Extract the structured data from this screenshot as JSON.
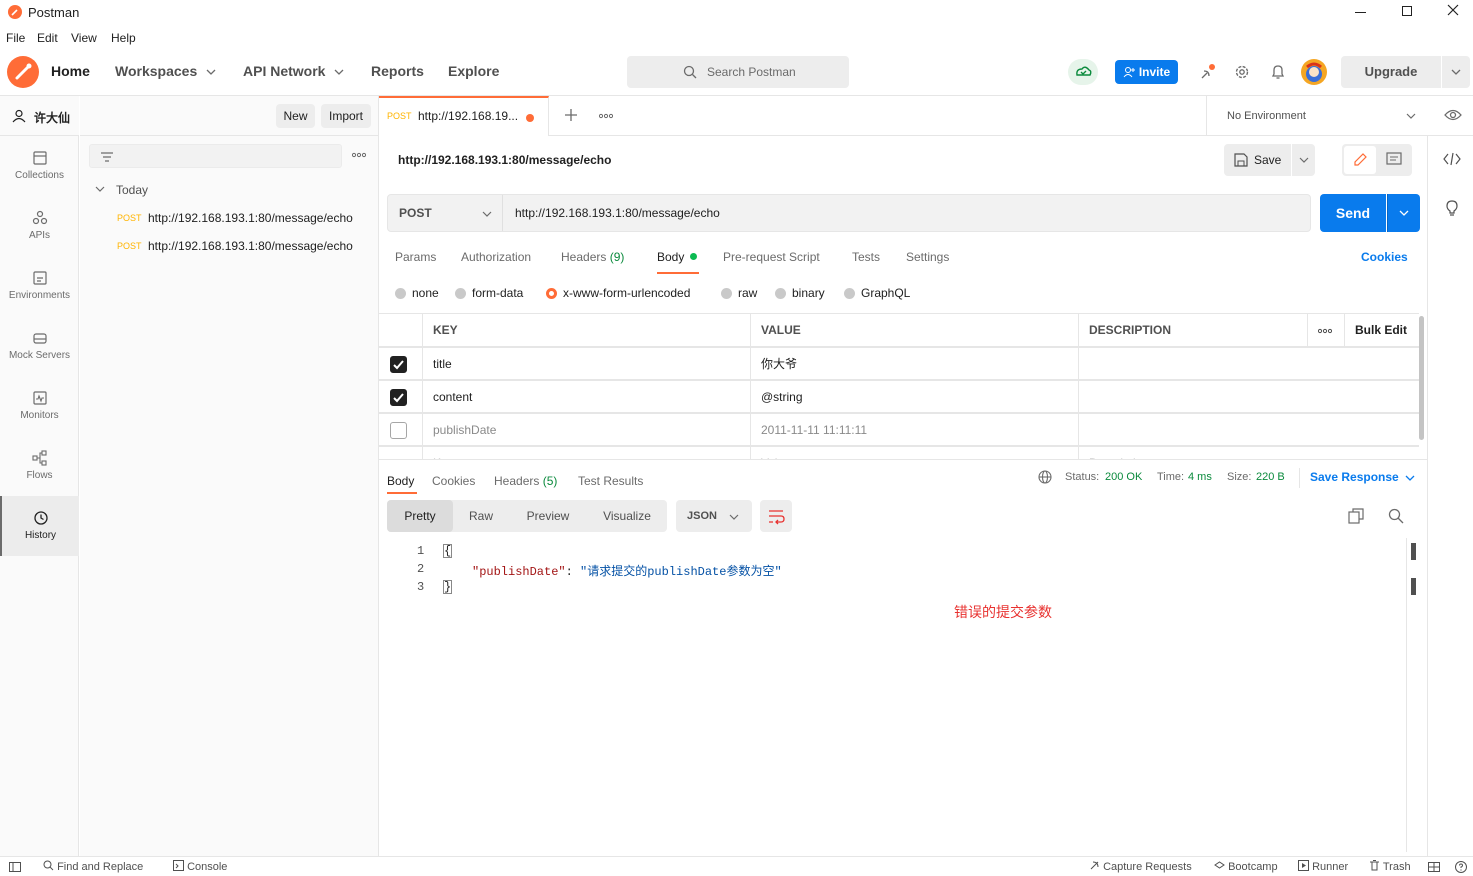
{
  "window": {
    "title": "Postman"
  },
  "menu": [
    "File",
    "Edit",
    "View",
    "Help"
  ],
  "nav": {
    "home": "Home",
    "workspaces": "Workspaces",
    "api_network": "API Network",
    "reports": "Reports",
    "explore": "Explore",
    "search_placeholder": "Search Postman",
    "invite": "Invite",
    "upgrade": "Upgrade"
  },
  "workspace": {
    "user": "许大仙",
    "new_label": "New",
    "import_label": "Import"
  },
  "leftbar": [
    "Collections",
    "APIs",
    "Environments",
    "Mock Servers",
    "Monitors",
    "Flows",
    "History"
  ],
  "history": {
    "group": "Today",
    "items": [
      {
        "method": "POST",
        "url": "http://192.168.193.1:80/message/echo"
      },
      {
        "method": "POST",
        "url": "http://192.168.193.1:80/message/echo"
      }
    ]
  },
  "request_tab": {
    "method": "POST",
    "title": "http://192.168.19..."
  },
  "environment": "No Environment",
  "request": {
    "name": "http://192.168.193.1:80/message/echo",
    "save_label": "Save",
    "method": "POST",
    "url": "http://192.168.193.1:80/message/echo",
    "send_label": "Send"
  },
  "req_tabs": {
    "params": "Params",
    "authorization": "Authorization",
    "headers": "Headers",
    "headers_count": "(9)",
    "body": "Body",
    "pre_request": "Pre-request Script",
    "tests": "Tests",
    "settings": "Settings",
    "cookies": "Cookies"
  },
  "body_types": [
    "none",
    "form-data",
    "x-www-form-urlencoded",
    "raw",
    "binary",
    "GraphQL"
  ],
  "params_table": {
    "headers": {
      "key": "KEY",
      "value": "VALUE",
      "description": "DESCRIPTION",
      "bulk_edit": "Bulk Edit"
    },
    "rows": [
      {
        "checked": true,
        "key": "title",
        "value": "你大爷",
        "description": ""
      },
      {
        "checked": true,
        "key": "content",
        "value": "@string",
        "description": ""
      },
      {
        "checked": false,
        "key": "publishDate",
        "value": "2011-11-11 11:11:11",
        "description": ""
      }
    ],
    "placeholder": {
      "key": "Key",
      "value": "Value",
      "description": "Description"
    }
  },
  "response": {
    "tabs": {
      "body": "Body",
      "cookies": "Cookies",
      "headers": "Headers",
      "headers_count": "(5)",
      "test_results": "Test Results"
    },
    "status_label": "Status:",
    "status": "200 OK",
    "time_label": "Time:",
    "time": "4 ms",
    "size_label": "Size:",
    "size": "220 B",
    "save_response": "Save Response",
    "view_tabs": [
      "Pretty",
      "Raw",
      "Preview",
      "Visualize"
    ],
    "format": "JSON",
    "lines": [
      {
        "num": "1",
        "text": "{"
      },
      {
        "num": "2",
        "key": "\"publishDate\"",
        "sep": ": ",
        "value": "\"请求提交的publishDate参数为空\""
      },
      {
        "num": "3",
        "text": "}"
      }
    ],
    "annotation": "错误的提交参数",
    "annotation_color": "#e8312f"
  },
  "footer": {
    "find_replace": "Find and Replace",
    "console": "Console",
    "capture": "Capture Requests",
    "bootcamp": "Bootcamp",
    "runner": "Runner",
    "trash": "Trash"
  },
  "colors": {
    "accent": "#ff6c37",
    "primary_blue": "#097bed",
    "post_method": "#ffb400"
  }
}
